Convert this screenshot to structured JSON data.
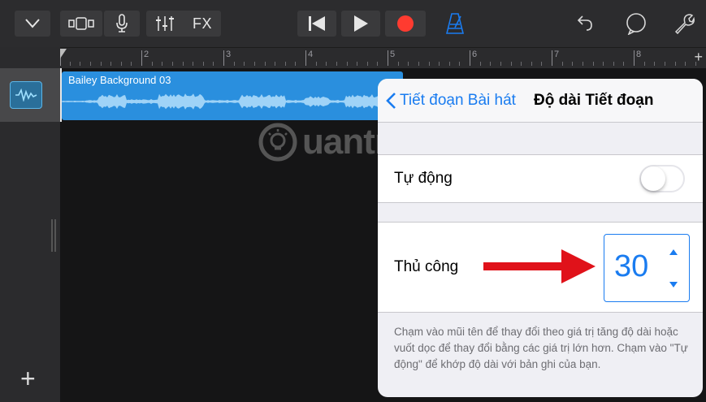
{
  "toolbar": {
    "icons": [
      "tracks-dropdown-icon",
      "browser-view-icon",
      "microphone-icon",
      "mixer-icon",
      "rewind-icon",
      "play-icon",
      "record-icon",
      "metronome-icon",
      "undo-icon",
      "loop-browser-icon",
      "settings-wrench-icon"
    ],
    "fx_label": "FX"
  },
  "ruler": {
    "bar_numbers": [
      "2",
      "3",
      "4",
      "5",
      "6",
      "7",
      "8"
    ],
    "add_section_label": "+"
  },
  "track": {
    "region_title": "Bailey Background 03",
    "add_track_label": "+"
  },
  "watermark": {
    "text": "uantrimang"
  },
  "popover": {
    "back_label": "Tiết đoạn Bài hát",
    "title": "Độ dài Tiết đoạn",
    "auto_label": "Tự động",
    "auto_enabled": false,
    "manual_label": "Thủ công",
    "manual_value": "30",
    "footnote": "Chạm vào mũi tên để thay đổi theo giá trị tăng độ dài hoặc vuốt dọc để thay đổi bằng các giá trị lớn hơn. Chạm vào \"Tự động\" để khớp độ dài với bản ghi của bạn."
  },
  "colors": {
    "accent": "#1a7cf0",
    "region": "#2a8fde",
    "record": "#ff3b30",
    "annotation_arrow": "#e0121a"
  }
}
